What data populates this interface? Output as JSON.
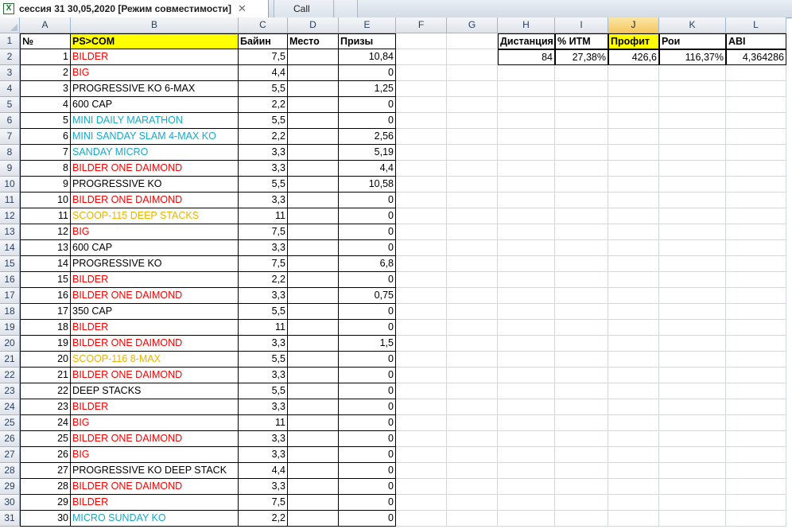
{
  "tabs": [
    {
      "title": "сессия 31  30,05,2020  [Режим совместимости]",
      "close": "✕",
      "active": true
    },
    {
      "title": "Call",
      "active": false
    }
  ],
  "columns": [
    "A",
    "B",
    "C",
    "D",
    "E",
    "F",
    "G",
    "H",
    "I",
    "J",
    "K",
    "L"
  ],
  "selected_column": "J",
  "header_row": {
    "no": "№",
    "name": "PS>COM",
    "buyin": "Байин",
    "place": "Место",
    "prize": "Призы"
  },
  "summary": {
    "headers": [
      "Дистанция",
      "% ИТМ",
      "Профит",
      "Рои",
      "ABI"
    ],
    "values": [
      "84",
      "27,38%",
      "426,6",
      "116,37%",
      "4,364286"
    ]
  },
  "rows": [
    {
      "n": "1",
      "name": "BILDER",
      "color": "red",
      "buyin": "7,5",
      "place": "",
      "prize": "10,84"
    },
    {
      "n": "2",
      "name": "BIG",
      "color": "red",
      "buyin": "4,4",
      "place": "",
      "prize": "0"
    },
    {
      "n": "3",
      "name": "PROGRESSIVE KO 6-MAX",
      "color": "black",
      "buyin": "5,5",
      "place": "",
      "prize": "1,25"
    },
    {
      "n": "4",
      "name": "600 CAP",
      "color": "black",
      "buyin": "2,2",
      "place": "",
      "prize": "0"
    },
    {
      "n": "5",
      "name": "MINI DAILY MARATHON",
      "color": "cyan",
      "buyin": "5,5",
      "place": "",
      "prize": "0"
    },
    {
      "n": "6",
      "name": "MINI SANDAY SLAM 4-MAX KO",
      "color": "cyan",
      "buyin": "2,2",
      "place": "",
      "prize": "2,56"
    },
    {
      "n": "7",
      "name": "SANDAY MICRO",
      "color": "cyan",
      "buyin": "3,3",
      "place": "",
      "prize": "5,19"
    },
    {
      "n": "8",
      "name": "BILDER ONE DAIMOND",
      "color": "red",
      "buyin": "3,3",
      "place": "",
      "prize": "4,4"
    },
    {
      "n": "9",
      "name": "PROGRESSIVE KO",
      "color": "black",
      "buyin": "5,5",
      "place": "",
      "prize": "10,58"
    },
    {
      "n": "10",
      "name": "BILDER ONE DAIMOND",
      "color": "red",
      "buyin": "3,3",
      "place": "",
      "prize": "0"
    },
    {
      "n": "11",
      "name": "SCOOP-115 DEEP STACKS",
      "color": "orange",
      "buyin": "11",
      "place": "",
      "prize": "0"
    },
    {
      "n": "12",
      "name": "BIG",
      "color": "red",
      "buyin": "7,5",
      "place": "",
      "prize": "0"
    },
    {
      "n": "13",
      "name": "600 CAP",
      "color": "black",
      "buyin": "3,3",
      "place": "",
      "prize": "0"
    },
    {
      "n": "14",
      "name": "PROGRESSIVE KO",
      "color": "black",
      "buyin": "7,5",
      "place": "",
      "prize": "6,8"
    },
    {
      "n": "15",
      "name": "BILDER",
      "color": "red",
      "buyin": "2,2",
      "place": "",
      "prize": "0"
    },
    {
      "n": "16",
      "name": "BILDER ONE DAIMOND",
      "color": "red",
      "buyin": "3,3",
      "place": "",
      "prize": "0,75"
    },
    {
      "n": "17",
      "name": "350 CAP",
      "color": "black",
      "buyin": "5,5",
      "place": "",
      "prize": "0"
    },
    {
      "n": "18",
      "name": "BILDER",
      "color": "red",
      "buyin": "11",
      "place": "",
      "prize": "0"
    },
    {
      "n": "19",
      "name": "BILDER ONE DAIMOND",
      "color": "red",
      "buyin": "3,3",
      "place": "",
      "prize": "1,5"
    },
    {
      "n": "20",
      "name": "SCOOP-116 8-MAX",
      "color": "orange",
      "buyin": "5,5",
      "place": "",
      "prize": "0"
    },
    {
      "n": "21",
      "name": "BILDER ONE DAIMOND",
      "color": "red",
      "buyin": "3,3",
      "place": "",
      "prize": "0"
    },
    {
      "n": "22",
      "name": "DEEP STACKS",
      "color": "black",
      "buyin": "5,5",
      "place": "",
      "prize": "0"
    },
    {
      "n": "23",
      "name": "BILDER",
      "color": "red",
      "buyin": "3,3",
      "place": "",
      "prize": "0"
    },
    {
      "n": "24",
      "name": "BIG",
      "color": "red",
      "buyin": "11",
      "place": "",
      "prize": "0"
    },
    {
      "n": "25",
      "name": "BILDER ONE DAIMOND",
      "color": "red",
      "buyin": "3,3",
      "place": "",
      "prize": "0"
    },
    {
      "n": "26",
      "name": "BIG",
      "color": "red",
      "buyin": "3,3",
      "place": "",
      "prize": "0"
    },
    {
      "n": "27",
      "name": "PROGRESSIVE KO DEEP STACK",
      "color": "black",
      "buyin": "4,4",
      "place": "",
      "prize": "0"
    },
    {
      "n": "28",
      "name": "BILDER ONE DAIMOND",
      "color": "red",
      "buyin": "3,3",
      "place": "",
      "prize": "0"
    },
    {
      "n": "29",
      "name": "BILDER",
      "color": "red",
      "buyin": "7,5",
      "place": "",
      "prize": "0"
    },
    {
      "n": "30",
      "name": "MICRO SUNDAY KO",
      "color": "cyan",
      "buyin": "2,2",
      "place": "",
      "prize": "0"
    }
  ],
  "colors": {
    "red": "#ff0000",
    "cyan": "#17a9cf",
    "orange": "#f0b400",
    "black": "#000000",
    "yellow_fill": "#ffff00",
    "selected_header": "#f4c760"
  }
}
